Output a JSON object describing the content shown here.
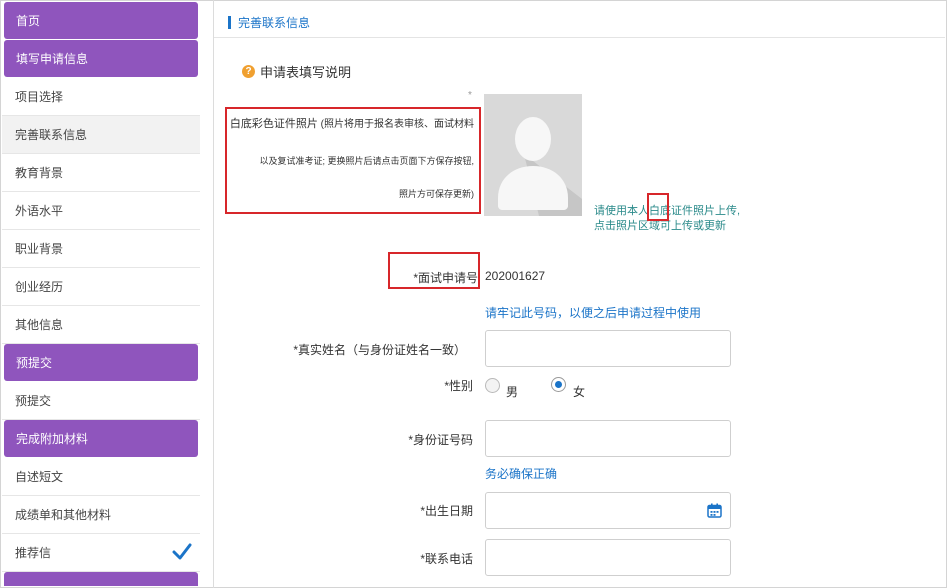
{
  "sidebar": {
    "items": [
      {
        "label": "首页",
        "type": "section"
      },
      {
        "label": "填写申请信息",
        "type": "section"
      },
      {
        "label": "项目选择",
        "type": "item"
      },
      {
        "label": "完善联系信息",
        "type": "item",
        "active": true
      },
      {
        "label": "教育背景",
        "type": "item"
      },
      {
        "label": "外语水平",
        "type": "item"
      },
      {
        "label": "职业背景",
        "type": "item"
      },
      {
        "label": "创业经历",
        "type": "item"
      },
      {
        "label": "其他信息",
        "type": "item"
      },
      {
        "label": "预提交",
        "type": "section"
      },
      {
        "label": "预提交",
        "type": "item"
      },
      {
        "label": "完成附加材料",
        "type": "section"
      },
      {
        "label": "自述短文",
        "type": "item"
      },
      {
        "label": "成绩单和其他材料",
        "type": "item"
      },
      {
        "label": "推荐信",
        "type": "item",
        "checked": true
      }
    ]
  },
  "main": {
    "page_title": "完善联系信息",
    "instructions_title": "申请表填写说明",
    "photo_required_mark": "*",
    "photo_note": {
      "label": "白底彩色证件照片",
      "line1": "(照片将用于报名表审核、面试材料",
      "line2": "以及复试准考证; 更换照片后请点击页面下方保存按钮,",
      "line3": "照片方可保存更新)"
    },
    "photo_hint": {
      "line1": "请使用本人白底证件照片上传,",
      "line2": "点击照片区域可上传或更新"
    },
    "application_no": {
      "label": "*面试申请号",
      "value": "202001627",
      "note": "请牢记此号码，以便之后申请过程中使用"
    },
    "real_name": {
      "label": "*真实姓名（与身份证姓名一致）",
      "value": ""
    },
    "gender": {
      "label": "*性别",
      "male": "男",
      "female": "女",
      "selected": "female"
    },
    "id_number": {
      "label": "*身份证号码",
      "value": "",
      "note": "务必确保正确"
    },
    "birth_date": {
      "label": "*出生日期",
      "value": ""
    },
    "phone": {
      "label": "*联系电话",
      "value": ""
    }
  },
  "colors": {
    "sidebar_section": "#8f55bd",
    "accent_blue": "#1b74c8",
    "highlight_red": "#d7262a",
    "hint_teal": "#2a8a8a"
  }
}
